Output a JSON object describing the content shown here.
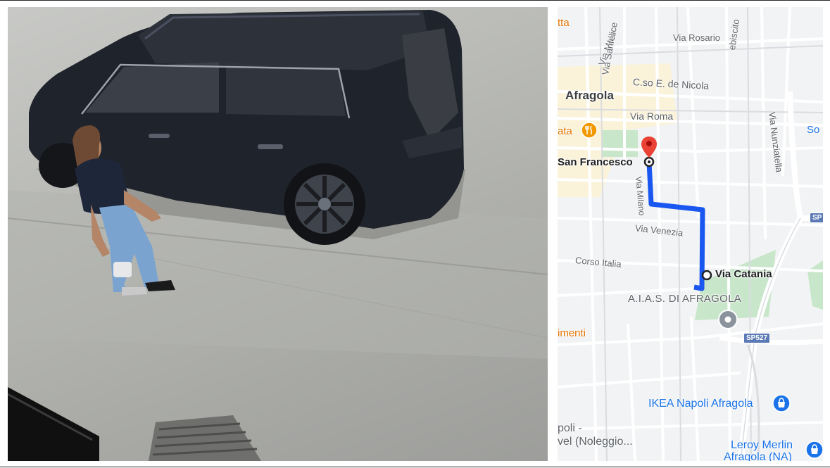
{
  "photo": {
    "subject": "woman-walking-beside-suv"
  },
  "map": {
    "colors": {
      "route": "#1a57f0",
      "pin": "#ea4335",
      "park": "#c8e6c9",
      "shop_icon": "#1a73e8",
      "food_icon": "#f29900"
    },
    "labels": {
      "afragola": "Afragola",
      "via_roma": "Via Roma",
      "corso_de_nicola": "C.so E. de Nicola",
      "via_rosario": "Via Rosario",
      "via_sanfelice": "Via Sanfelice",
      "via_mele": "Via Mele",
      "plebiscito": "ebiscito",
      "via_nunziatella": "Via Nunziatella",
      "via_milano": "Via Milano",
      "via_venezia": "Via Venezia",
      "corso_italia": "Corso Italia",
      "san_francesco": "San Francesco",
      "via_catania": "Via Catania",
      "aias": "A.I.A.S. DI AFRAGOLA",
      "ikea": "IKEA Napoli Afragola",
      "leroy_1": "Leroy Merlin",
      "leroy_2": "Afragola (NA)",
      "napoli_1": "poli -",
      "napoli_2": "vel (Noleggio...",
      "menti": "imenti",
      "tta_top": "tta",
      "ata_mid": "ata",
      "so_edge": "So",
      "sp527": "SP527",
      "sp_edge": "SP"
    }
  }
}
